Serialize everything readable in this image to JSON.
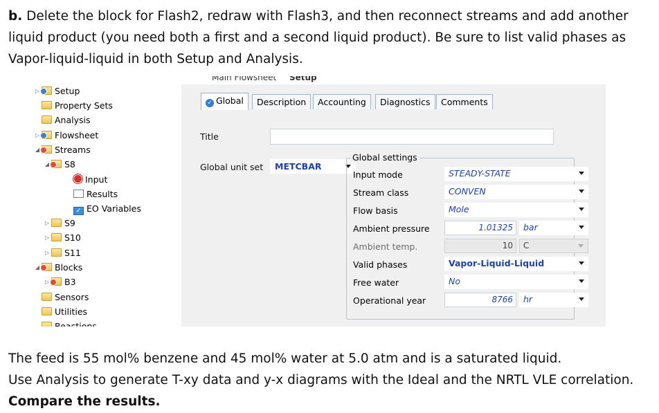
{
  "instructions": {
    "part_label": "b.",
    "line1_rest": " Delete the block for Flash2, redraw with Flash3, and then reconnect streams and add another",
    "line2": "liquid product (you need both a first and a second liquid product). Be sure to list valid phases as",
    "line3": "Vapor-liquid-liquid in both Setup and Analysis.",
    "bottom1": "The feed is 55 mol% benzene and 45 mol% water at 5.0 atm and is a saturated liquid.",
    "bottom2": "Use Analysis to generate T-xy data and y-x diagrams with the Ideal and the NRTL VLE correlation.",
    "bottom3": "Compare the results."
  },
  "doc_tabs": [
    "Main Flowsheet",
    "Setup"
  ],
  "tree": [
    {
      "label": "Setup",
      "icon": "folder-check-icon"
    },
    {
      "label": "Property Sets",
      "icon": "folder-icon"
    },
    {
      "label": "Analysis",
      "icon": "folder-icon"
    },
    {
      "label": "Flowsheet",
      "icon": "folder-check-icon"
    },
    {
      "label": "Streams",
      "icon": "folder-warning-icon"
    },
    {
      "label": "S8",
      "icon": "folder-warning-icon"
    },
    {
      "label": "Input",
      "icon": "red-error-icon"
    },
    {
      "label": "Results",
      "icon": "results-document-icon"
    },
    {
      "label": "EO Variables",
      "icon": "eo-variables-icon"
    },
    {
      "label": "S9",
      "icon": "folder-icon"
    },
    {
      "label": "S10",
      "icon": "folder-icon"
    },
    {
      "label": "S11",
      "icon": "folder-icon"
    },
    {
      "label": "Blocks",
      "icon": "folder-warning-icon"
    },
    {
      "label": "B3",
      "icon": "folder-warning-icon"
    },
    {
      "label": "Sensors",
      "icon": "folder-icon"
    },
    {
      "label": "Utilities",
      "icon": "folder-icon"
    },
    {
      "label": "Reactions",
      "icon": "folder-icon"
    }
  ],
  "tabs": [
    "Global",
    "Description",
    "Accounting",
    "Diagnostics",
    "Comments"
  ],
  "form": {
    "title_label": "Title",
    "title_value": "",
    "unit_set_label": "Global unit set",
    "unit_set_value": "METCBAR",
    "group_title": "Global settings",
    "rows": [
      {
        "label": "Input mode",
        "value": "STEADY-STATE",
        "unit": ""
      },
      {
        "label": "Stream class",
        "value": "CONVEN",
        "unit": ""
      },
      {
        "label": "Flow basis",
        "value": "Mole",
        "unit": ""
      },
      {
        "label": "Ambient pressure",
        "value": "1.01325",
        "unit": "bar"
      },
      {
        "label": "Ambient temp.",
        "value": "10",
        "unit": "C"
      },
      {
        "label": "Valid phases",
        "value": "Vapor-Liquid-Liquid",
        "unit": ""
      },
      {
        "label": "Free water",
        "value": "No",
        "unit": ""
      },
      {
        "label": "Operational year",
        "value": "8766",
        "unit": "hr"
      }
    ]
  },
  "colors": {
    "value_blue": "#1d3fb0",
    "panel_bg": "#f0f0f0",
    "tab_border": "#9fb3c8"
  }
}
